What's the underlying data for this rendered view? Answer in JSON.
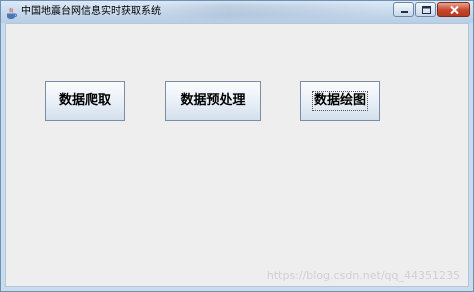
{
  "window": {
    "title": "中国地震台网信息实时获取系统"
  },
  "buttons": {
    "crawl": "数据爬取",
    "preprocess": "数据预处理",
    "plot": "数据绘图"
  },
  "watermark": "https://blog.csdn.net/qq_44351235"
}
